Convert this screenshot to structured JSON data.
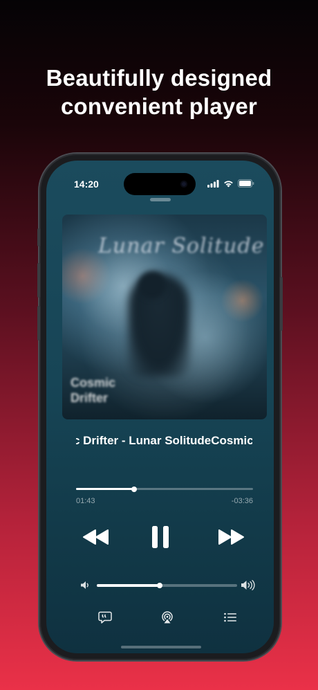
{
  "headline": {
    "line1": "Beautifully designed",
    "line2": "convenient player"
  },
  "status_bar": {
    "time": "14:20",
    "icons": [
      "cellular-signal-icon",
      "wifi-icon",
      "battery-icon"
    ]
  },
  "artwork": {
    "script_text": "Lunar Solitude",
    "title_line1": "Cosmic",
    "title_line2": "Drifter"
  },
  "now_playing": {
    "title_marquee": "Cosmic Drifter - Lunar SolitudeCosmic Drifter",
    "elapsed": "01:43",
    "remaining": "-03:36",
    "progress": 0.33
  },
  "controls": {
    "rewind_icon": "rewind-icon",
    "pause_icon": "pause-icon",
    "fast_forward_icon": "fast-forward-icon"
  },
  "volume": {
    "level": 0.45,
    "low_icon": "speaker-low-icon",
    "high_icon": "speaker-high-icon"
  },
  "bottom_bar": {
    "items": [
      "lyrics-icon",
      "airplay-icon",
      "queue-list-icon"
    ]
  },
  "colors": {
    "gradient_top": "#050305",
    "gradient_bottom": "#ea3148",
    "player_background": "#174556",
    "accent": "#ffffff"
  }
}
